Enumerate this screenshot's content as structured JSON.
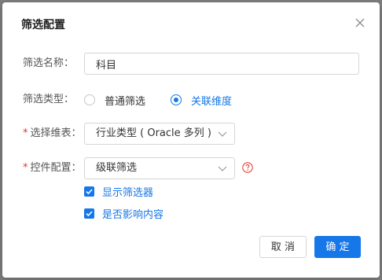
{
  "dialog": {
    "title": "筛选配置"
  },
  "form": {
    "name": {
      "label": "筛选名称：",
      "value": "科目"
    },
    "type": {
      "label": "筛选类型：",
      "options": [
        "普通筛选",
        "关联维度"
      ],
      "selected": "关联维度"
    },
    "dimension_table": {
      "required_mark": "*",
      "label": "选择维表：",
      "value": "行业类型 ( Oracle 多列 )"
    },
    "control": {
      "required_mark": "*",
      "label": "控件配置：",
      "value": "级联筛选",
      "help_icon": "question-circle-icon"
    },
    "checkboxes": [
      {
        "label": "显示筛选器",
        "checked": true
      },
      {
        "label": "是否影响内容",
        "checked": true
      }
    ]
  },
  "footer": {
    "cancel_label": "取 消",
    "ok_label": "确 定"
  },
  "colors": {
    "accent": "#1677e8",
    "required": "#e0352b",
    "help": "#e0352b"
  }
}
